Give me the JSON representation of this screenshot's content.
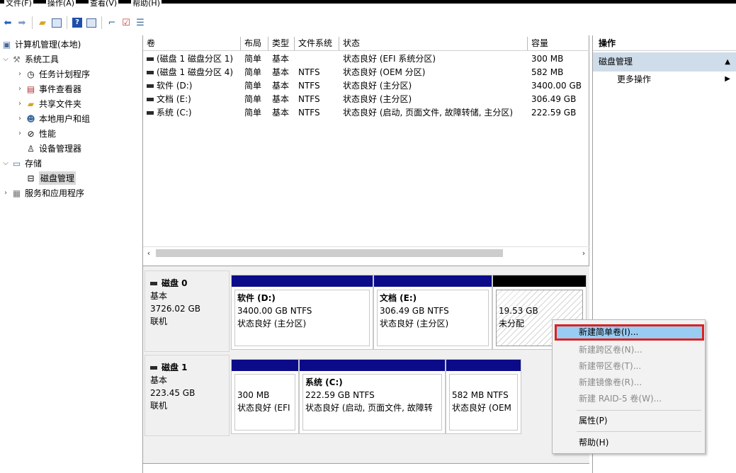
{
  "menu": {
    "items": [
      "文件(F)",
      "操作(A)",
      "查看(V)",
      "帮助(H)"
    ]
  },
  "toolbar": {
    "icons": [
      "back-arrow-icon",
      "forward-arrow-icon",
      "up-folder-icon",
      "show-hide-tree-icon",
      "help-icon",
      "properties-icon",
      "connect-icon",
      "check-icon",
      "list-icon"
    ]
  },
  "tree": {
    "root": "计算机管理(本地)",
    "system_tools": "系统工具",
    "task_scheduler": "任务计划程序",
    "event_viewer": "事件查看器",
    "shared_folders": "共享文件夹",
    "local_users": "本地用户和组",
    "performance": "性能",
    "device_manager": "设备管理器",
    "storage": "存储",
    "disk_management": "磁盘管理",
    "services": "服务和应用程序"
  },
  "volumes": {
    "headers": [
      "卷",
      "布局",
      "类型",
      "文件系统",
      "状态",
      "容量"
    ],
    "rows": [
      [
        "(磁盘 1 磁盘分区 1)",
        "简单",
        "基本",
        "",
        "状态良好 (EFI 系统分区)",
        "300 MB"
      ],
      [
        "(磁盘 1 磁盘分区 4)",
        "简单",
        "基本",
        "NTFS",
        "状态良好 (OEM 分区)",
        "582 MB"
      ],
      [
        "软件 (D:)",
        "简单",
        "基本",
        "NTFS",
        "状态良好 (主分区)",
        "3400.00 GB"
      ],
      [
        "文档 (E:)",
        "简单",
        "基本",
        "NTFS",
        "状态良好 (主分区)",
        "306.49 GB"
      ],
      [
        "系统 (C:)",
        "简单",
        "基本",
        "NTFS",
        "状态良好 (启动, 页面文件, 故障转储, 主分区)",
        "222.59 GB"
      ]
    ]
  },
  "disk0": {
    "name": "磁盘 0",
    "type": "基本",
    "size": "3726.02 GB",
    "status": "联机",
    "p1": {
      "title": "软件 (D:)",
      "size": "3400.00 GB NTFS",
      "status": "状态良好 (主分区)"
    },
    "p2": {
      "title": "文档 (E:)",
      "size": "306.49 GB NTFS",
      "status": "状态良好 (主分区)"
    },
    "p3": {
      "size": "19.53 GB",
      "status": "未分配"
    }
  },
  "disk1": {
    "name": "磁盘 1",
    "type": "基本",
    "size": "223.45 GB",
    "status": "联机",
    "p1": {
      "size": "300 MB",
      "status": "状态良好 (EFI"
    },
    "p2": {
      "title": "系统 (C:)",
      "size": "222.59 GB NTFS",
      "status": "状态良好 (启动, 页面文件, 故障转"
    },
    "p3": {
      "size": "582 MB NTFS",
      "status": "状态良好 (OEM"
    }
  },
  "actions": {
    "title": "操作",
    "section": "磁盘管理",
    "more": "更多操作"
  },
  "context_menu": {
    "new_simple": "新建简单卷(I)...",
    "new_spanned": "新建跨区卷(N)...",
    "new_striped": "新建带区卷(T)...",
    "new_mirrored": "新建镜像卷(R)...",
    "new_raid5": "新建 RAID-5 卷(W)...",
    "properties": "属性(P)",
    "help": "帮助(H)"
  },
  "colors": {
    "partition_bar": "#0b0b8a",
    "unallocated_bar": "#000000",
    "highlight": "#99ccf3",
    "highlight_border": "#e02020",
    "section_bg": "#cfdce9"
  }
}
